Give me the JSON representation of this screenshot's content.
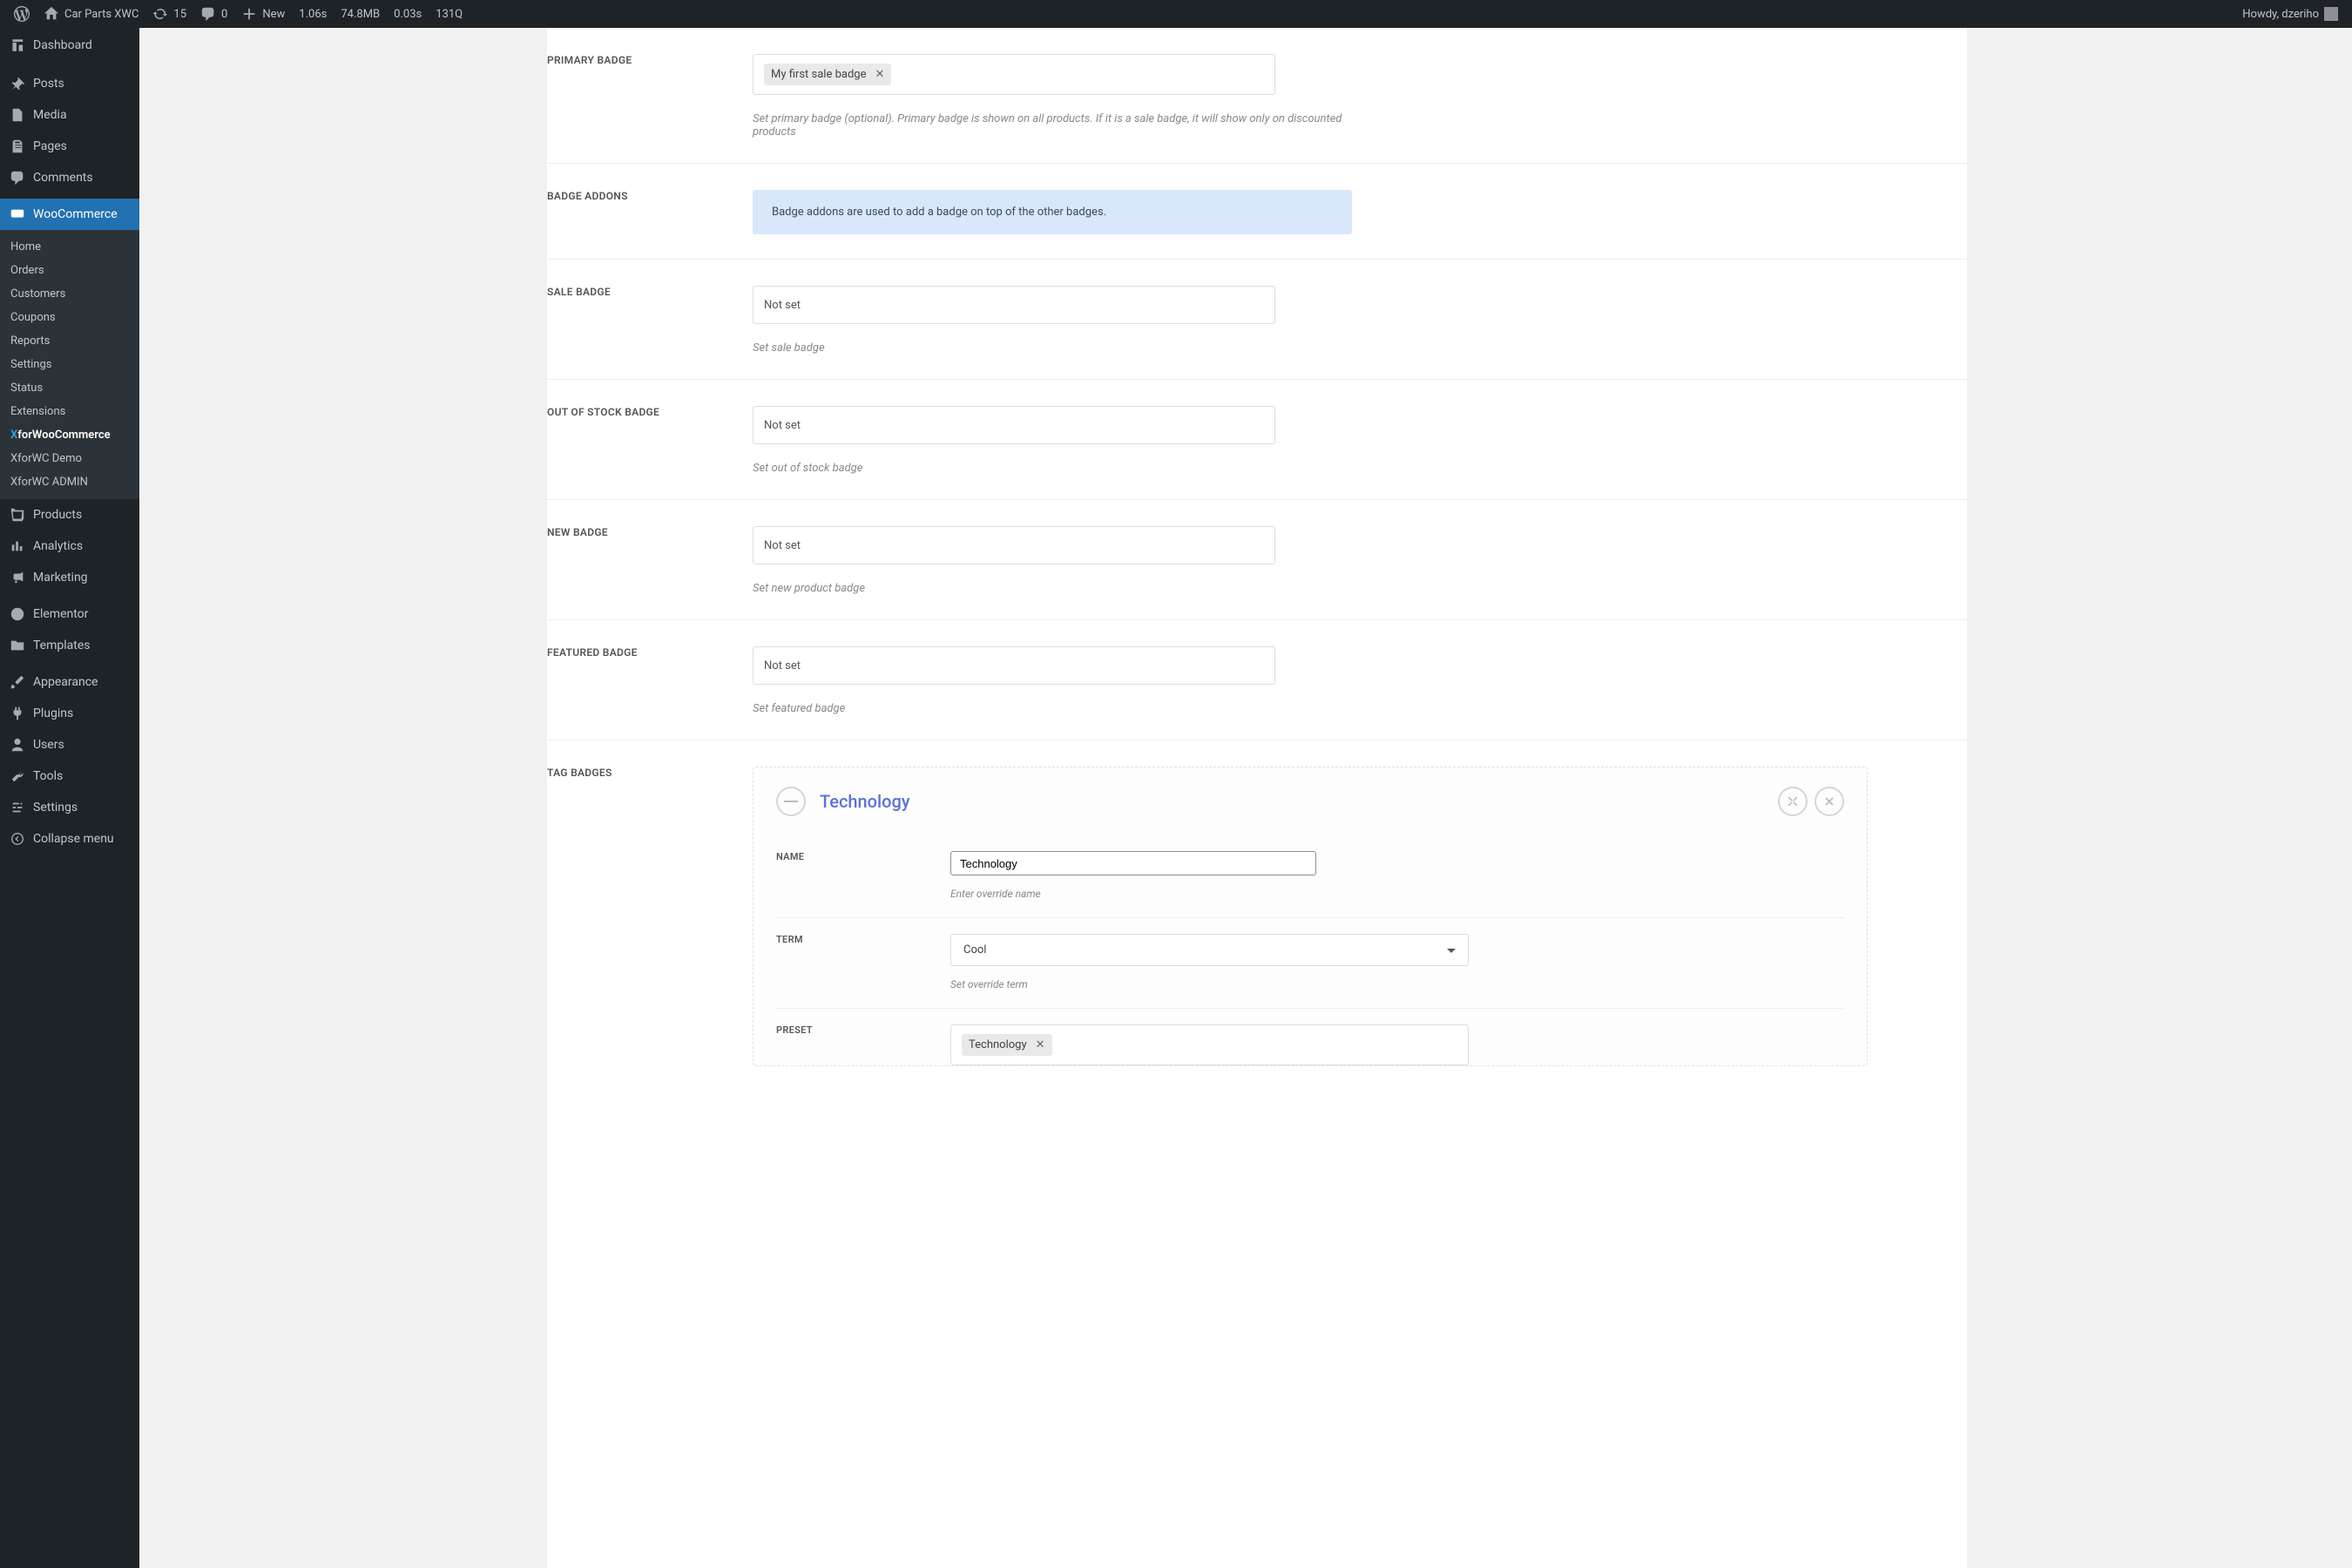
{
  "adminbar": {
    "site_name": "Car Parts XWC",
    "updates_count": "15",
    "comments_count": "0",
    "new_label": "New",
    "perf_time": "1.06s",
    "perf_mem": "74.8MB",
    "perf_dbtime": "0.03s",
    "perf_queries": "131Q",
    "howdy": "Howdy, dzeriho"
  },
  "sidebar": {
    "dashboard": "Dashboard",
    "posts": "Posts",
    "media": "Media",
    "pages": "Pages",
    "comments": "Comments",
    "woocommerce": "WooCommerce",
    "products": "Products",
    "analytics": "Analytics",
    "marketing": "Marketing",
    "elementor": "Elementor",
    "templates": "Templates",
    "appearance": "Appearance",
    "plugins": "Plugins",
    "users": "Users",
    "tools": "Tools",
    "settings": "Settings",
    "collapse": "Collapse menu",
    "sub": {
      "home": "Home",
      "orders": "Orders",
      "customers": "Customers",
      "coupons": "Coupons",
      "reports": "Reports",
      "settings": "Settings",
      "status": "Status",
      "extensions": "Extensions",
      "xforwc": "forWooCommerce",
      "xforwc_demo": "XforWC Demo",
      "xforwc_admin": "XforWC ADMIN"
    }
  },
  "form": {
    "primary_badge_label": "PRIMARY BADGE",
    "primary_badge_value": "My first sale badge",
    "primary_badge_helper": "Set primary badge (optional). Primary badge is shown on all products. If it is a sale badge, it will show only on discounted products",
    "badge_addons_label": "BADGE ADDONS",
    "badge_addons_info": "Badge addons are used to add a badge on top of the other badges.",
    "sale_badge_label": "SALE BADGE",
    "sale_badge_value": "Not set",
    "sale_badge_helper": "Set sale badge",
    "oos_badge_label": "OUT OF STOCK BADGE",
    "oos_badge_value": "Not set",
    "oos_badge_helper": "Set out of stock badge",
    "new_badge_label": "NEW BADGE",
    "new_badge_value": "Not set",
    "new_badge_helper": "Set new product badge",
    "featured_badge_label": "FEATURED BADGE",
    "featured_badge_value": "Not set",
    "featured_badge_helper": "Set featured badge",
    "tag_badges_label": "TAG BADGES"
  },
  "tagbadge": {
    "title": "Technology",
    "name_label": "NAME",
    "name_value": "Technology",
    "name_helper": "Enter override name",
    "term_label": "TERM",
    "term_value": "Cool",
    "term_helper": "Set override term",
    "preset_label": "PRESET",
    "preset_value": "Technology"
  }
}
